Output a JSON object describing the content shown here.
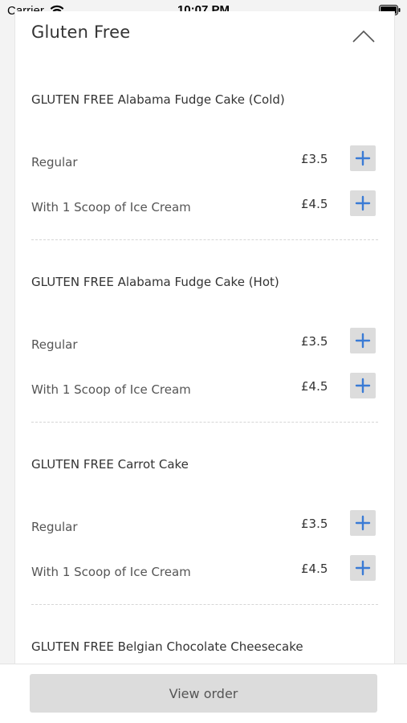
{
  "status_bar": {
    "carrier": "Carrier",
    "time": "10:07 PM"
  },
  "section": {
    "title": "Gluten Free",
    "collapse_icon": "chevron-up-icon"
  },
  "items": [
    {
      "title": "GLUTEN FREE Alabama Fudge Cake (Cold)",
      "options": [
        {
          "label": "Regular",
          "price": "£3.5"
        },
        {
          "label": "With 1 Scoop of Ice Cream",
          "price": "£4.5"
        }
      ]
    },
    {
      "title": "GLUTEN FREE Alabama Fudge Cake (Hot)",
      "options": [
        {
          "label": "Regular",
          "price": "£3.5"
        },
        {
          "label": "With 1 Scoop of Ice Cream",
          "price": "£4.5"
        }
      ]
    },
    {
      "title": "GLUTEN FREE Carrot Cake",
      "options": [
        {
          "label": "Regular",
          "price": "£3.5"
        },
        {
          "label": "With 1 Scoop of Ice Cream",
          "price": "£4.5"
        }
      ]
    },
    {
      "title": "GLUTEN FREE Belgian Chocolate Cheesecake",
      "options": []
    }
  ],
  "add_icon": "plus-icon",
  "colors": {
    "accent": "#3a7bd5",
    "button_bg": "#dcdcdc"
  },
  "footer": {
    "view_order_label": "View order"
  }
}
